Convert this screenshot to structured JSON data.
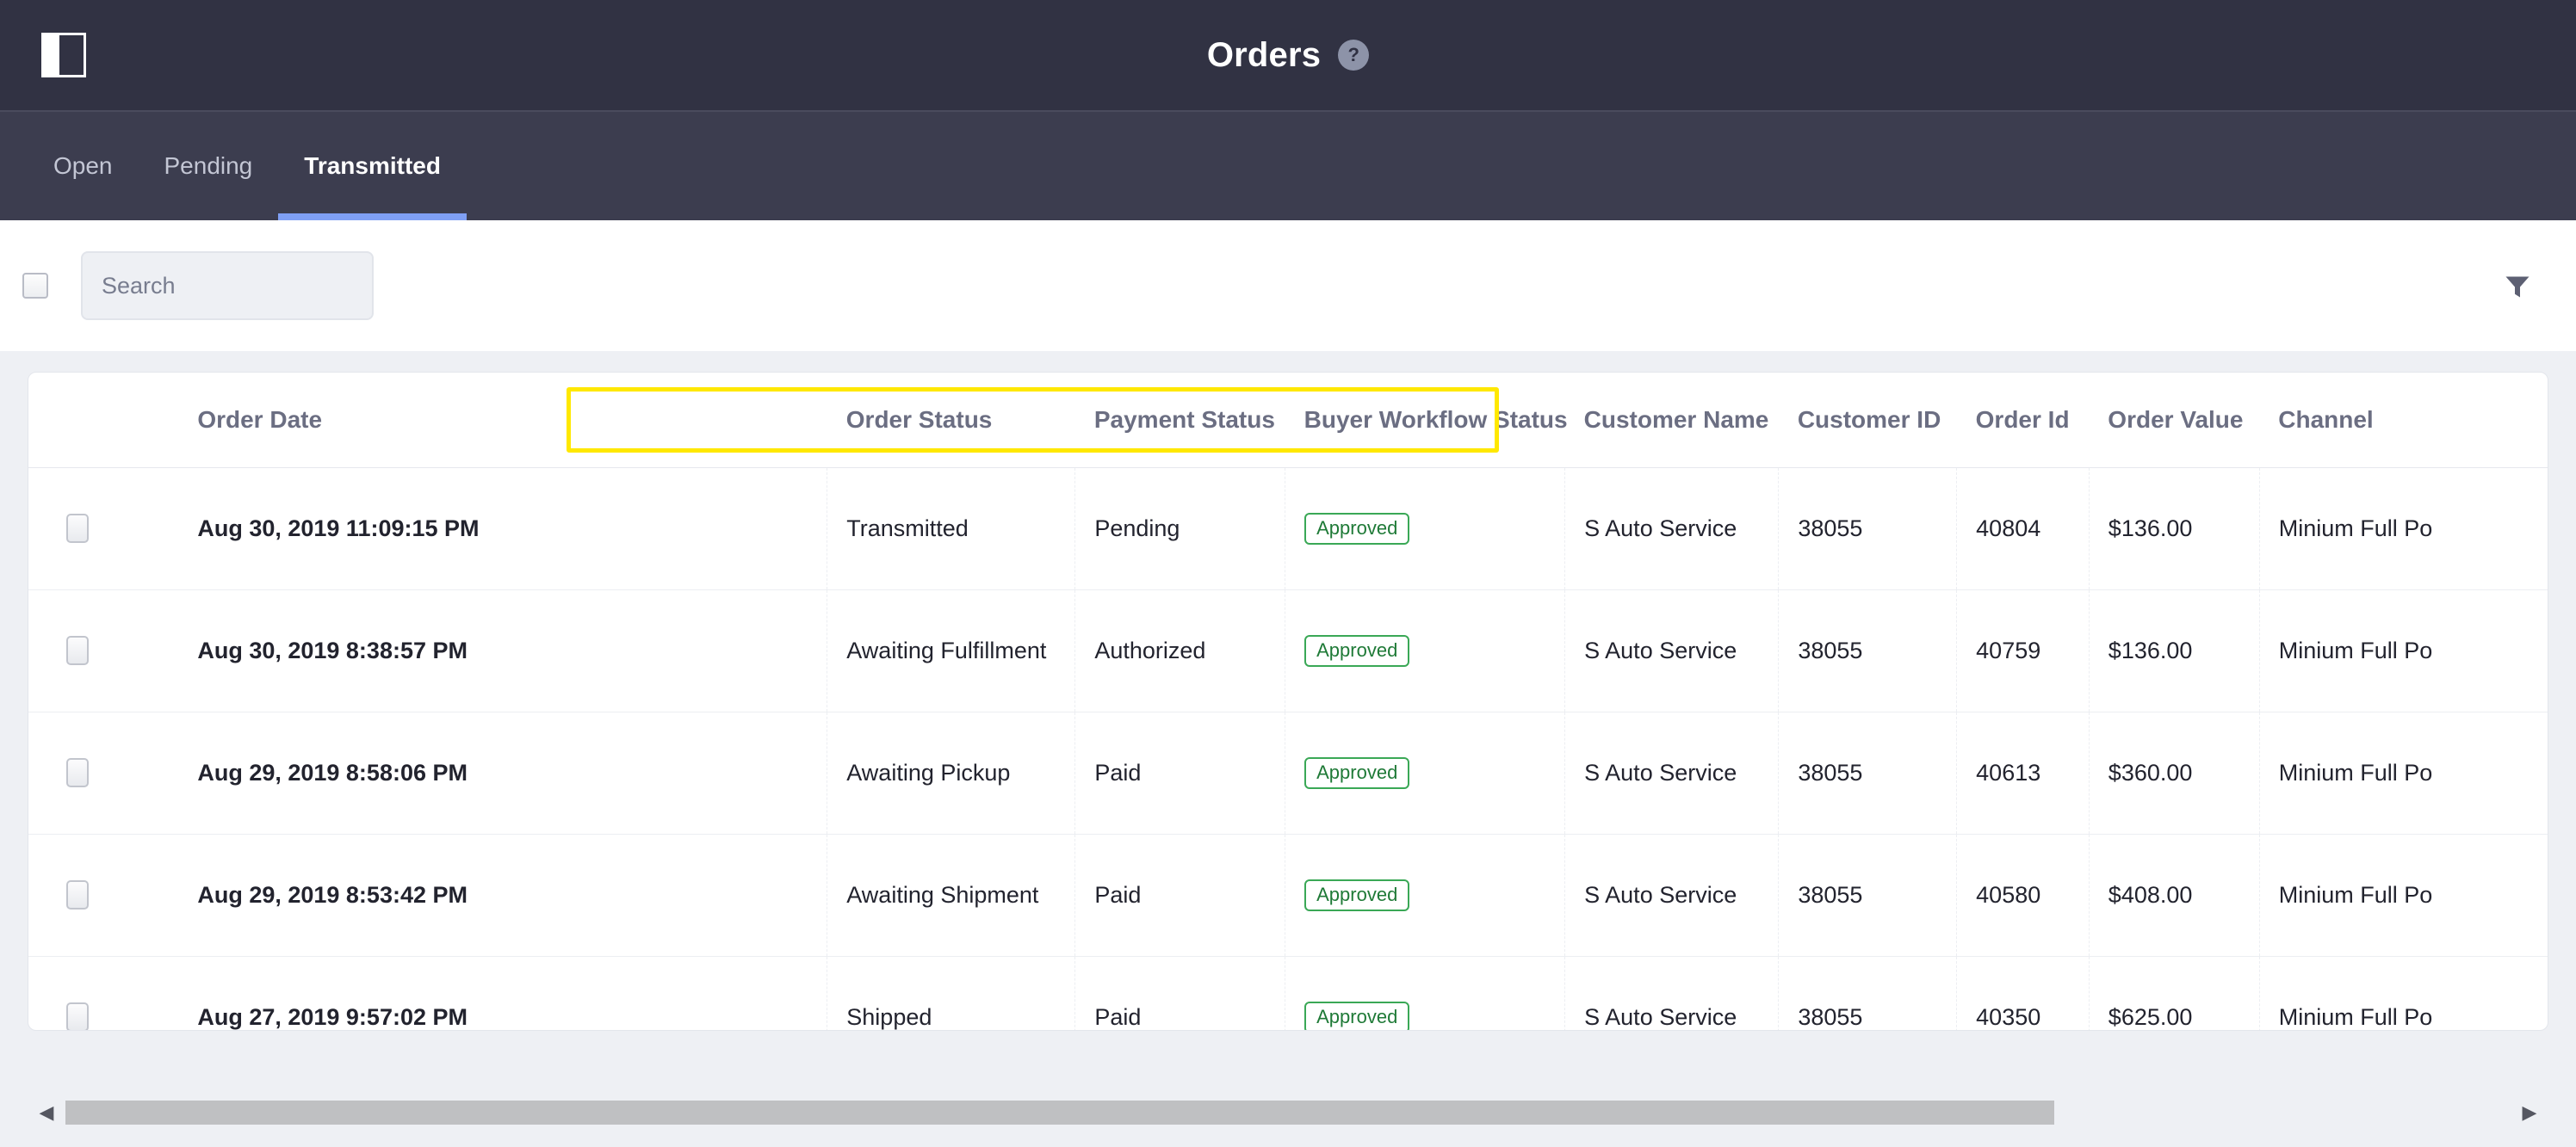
{
  "header": {
    "title": "Orders",
    "help_label": "?",
    "sidebar_toggle_name": "sidebar-toggle"
  },
  "tabs": [
    {
      "label": "Open",
      "active": false
    },
    {
      "label": "Pending",
      "active": false
    },
    {
      "label": "Transmitted",
      "active": true
    }
  ],
  "toolbar": {
    "search_placeholder": "Search",
    "search_value": "",
    "search_icon": "search-icon",
    "filter_icon": "filter-icon",
    "select_all_checked": false
  },
  "table": {
    "columns": [
      "Order Date",
      "Order Status",
      "Payment Status",
      "Buyer Workflow Status",
      "Customer Name",
      "Customer ID",
      "Order Id",
      "Order Value",
      "Channel"
    ],
    "highlight": {
      "color": "#ffe800",
      "columns": [
        "Order Status",
        "Payment Status",
        "Buyer Workflow Status"
      ]
    },
    "rows": [
      {
        "order_date": "Aug 30, 2019 11:09:15 PM",
        "order_status": "Transmitted",
        "payment_status": "Pending",
        "buyer_workflow_status": "Approved",
        "customer_name": "S Auto Service",
        "customer_id": "38055",
        "order_id": "40804",
        "order_value": "$136.00",
        "channel": "Minium Full Po"
      },
      {
        "order_date": "Aug 30, 2019 8:38:57 PM",
        "order_status": "Awaiting Fulfillment",
        "payment_status": "Authorized",
        "buyer_workflow_status": "Approved",
        "customer_name": "S Auto Service",
        "customer_id": "38055",
        "order_id": "40759",
        "order_value": "$136.00",
        "channel": "Minium Full Po"
      },
      {
        "order_date": "Aug 29, 2019 8:58:06 PM",
        "order_status": "Awaiting Pickup",
        "payment_status": "Paid",
        "buyer_workflow_status": "Approved",
        "customer_name": "S Auto Service",
        "customer_id": "38055",
        "order_id": "40613",
        "order_value": "$360.00",
        "channel": "Minium Full Po"
      },
      {
        "order_date": "Aug 29, 2019 8:53:42 PM",
        "order_status": "Awaiting Shipment",
        "payment_status": "Paid",
        "buyer_workflow_status": "Approved",
        "customer_name": "S Auto Service",
        "customer_id": "38055",
        "order_id": "40580",
        "order_value": "$408.00",
        "channel": "Minium Full Po"
      },
      {
        "order_date": "Aug 27, 2019 9:57:02 PM",
        "order_status": "Shipped",
        "payment_status": "Paid",
        "buyer_workflow_status": "Approved",
        "customer_name": "S Auto Service",
        "customer_id": "38055",
        "order_id": "40350",
        "order_value": "$625.00",
        "channel": "Minium Full Po"
      }
    ]
  },
  "scrollbar": {
    "left_arrow": "◀",
    "right_arrow": "▶"
  },
  "colors": {
    "topbar": "#313243",
    "tabbar": "#3c3d4f",
    "tab_active_underline": "#7f9ff4",
    "highlight": "#ffe800",
    "badge_green": "#3aa856"
  }
}
